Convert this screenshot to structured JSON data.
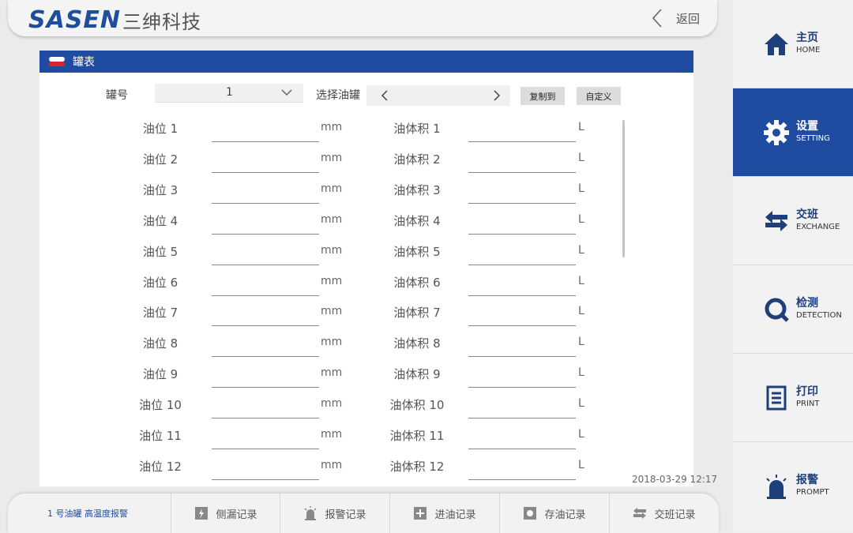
{
  "header": {
    "logo_text": "SASEN",
    "logo_cn": "三绅科技",
    "back_label": "返回"
  },
  "sidebar": {
    "items": [
      {
        "cn": "主页",
        "en": "HOME",
        "icon": "home-icon",
        "active": false
      },
      {
        "cn": "设置",
        "en": "SETTING",
        "icon": "gear-icon",
        "active": true
      },
      {
        "cn": "交班",
        "en": "EXCHANGE",
        "icon": "exchange-icon",
        "active": false
      },
      {
        "cn": "检测",
        "en": "DETECTION",
        "icon": "detection-icon",
        "active": false
      },
      {
        "cn": "打印",
        "en": "PRINT",
        "icon": "print-icon",
        "active": false
      },
      {
        "cn": "报警",
        "en": "PROMPT",
        "icon": "alarm-icon",
        "active": false
      }
    ]
  },
  "panel": {
    "title": "罐表",
    "tank_no_label": "罐号",
    "tank_no_value": "1",
    "select_tank_label": "选择油罐",
    "copy_button": "复制到",
    "custom_button": "自定义",
    "rows": [
      {
        "level_label": "油位 1",
        "level_value": "",
        "level_unit": "mm",
        "volume_label": "油体积 1",
        "volume_value": "",
        "volume_unit": "L"
      },
      {
        "level_label": "油位 2",
        "level_value": "",
        "level_unit": "mm",
        "volume_label": "油体积 2",
        "volume_value": "",
        "volume_unit": "L"
      },
      {
        "level_label": "油位 3",
        "level_value": "",
        "level_unit": "mm",
        "volume_label": "油体积 3",
        "volume_value": "",
        "volume_unit": "L"
      },
      {
        "level_label": "油位 4",
        "level_value": "",
        "level_unit": "mm",
        "volume_label": "油体积 4",
        "volume_value": "",
        "volume_unit": "L"
      },
      {
        "level_label": "油位 5",
        "level_value": "",
        "level_unit": "mm",
        "volume_label": "油体积 5",
        "volume_value": "",
        "volume_unit": "L"
      },
      {
        "level_label": "油位 6",
        "level_value": "",
        "level_unit": "mm",
        "volume_label": "油体积 6",
        "volume_value": "",
        "volume_unit": "L"
      },
      {
        "level_label": "油位 7",
        "level_value": "",
        "level_unit": "mm",
        "volume_label": "油体积 7",
        "volume_value": "",
        "volume_unit": "L"
      },
      {
        "level_label": "油位 8",
        "level_value": "",
        "level_unit": "mm",
        "volume_label": "油体积 8",
        "volume_value": "",
        "volume_unit": "L"
      },
      {
        "level_label": "油位 9",
        "level_value": "",
        "level_unit": "mm",
        "volume_label": "油体积 9",
        "volume_value": "",
        "volume_unit": "L"
      },
      {
        "level_label": "油位 10",
        "level_value": "",
        "level_unit": "mm",
        "volume_label": "油体积 10",
        "volume_value": "",
        "volume_unit": "L"
      },
      {
        "level_label": "油位 11",
        "level_value": "",
        "level_unit": "mm",
        "volume_label": "油体积 11",
        "volume_value": "",
        "volume_unit": "L"
      },
      {
        "level_label": "油位 12",
        "level_value": "",
        "level_unit": "mm",
        "volume_label": "油体积 12",
        "volume_value": "",
        "volume_unit": "L"
      }
    ]
  },
  "timestamp": "2018-03-29 12:17",
  "footer": {
    "alarm_message": "1 号油罐 高温度报警",
    "buttons": [
      {
        "label": "侧漏记录",
        "icon": "leak-icon"
      },
      {
        "label": "报警记录",
        "icon": "alarm-icon"
      },
      {
        "label": "进油记录",
        "icon": "oil-in-icon"
      },
      {
        "label": "存油记录",
        "icon": "oil-store-icon"
      },
      {
        "label": "交班记录",
        "icon": "exchange-icon"
      }
    ]
  },
  "colors": {
    "brand_blue": "#1f4ca0",
    "logo_red": "#d9242b"
  }
}
